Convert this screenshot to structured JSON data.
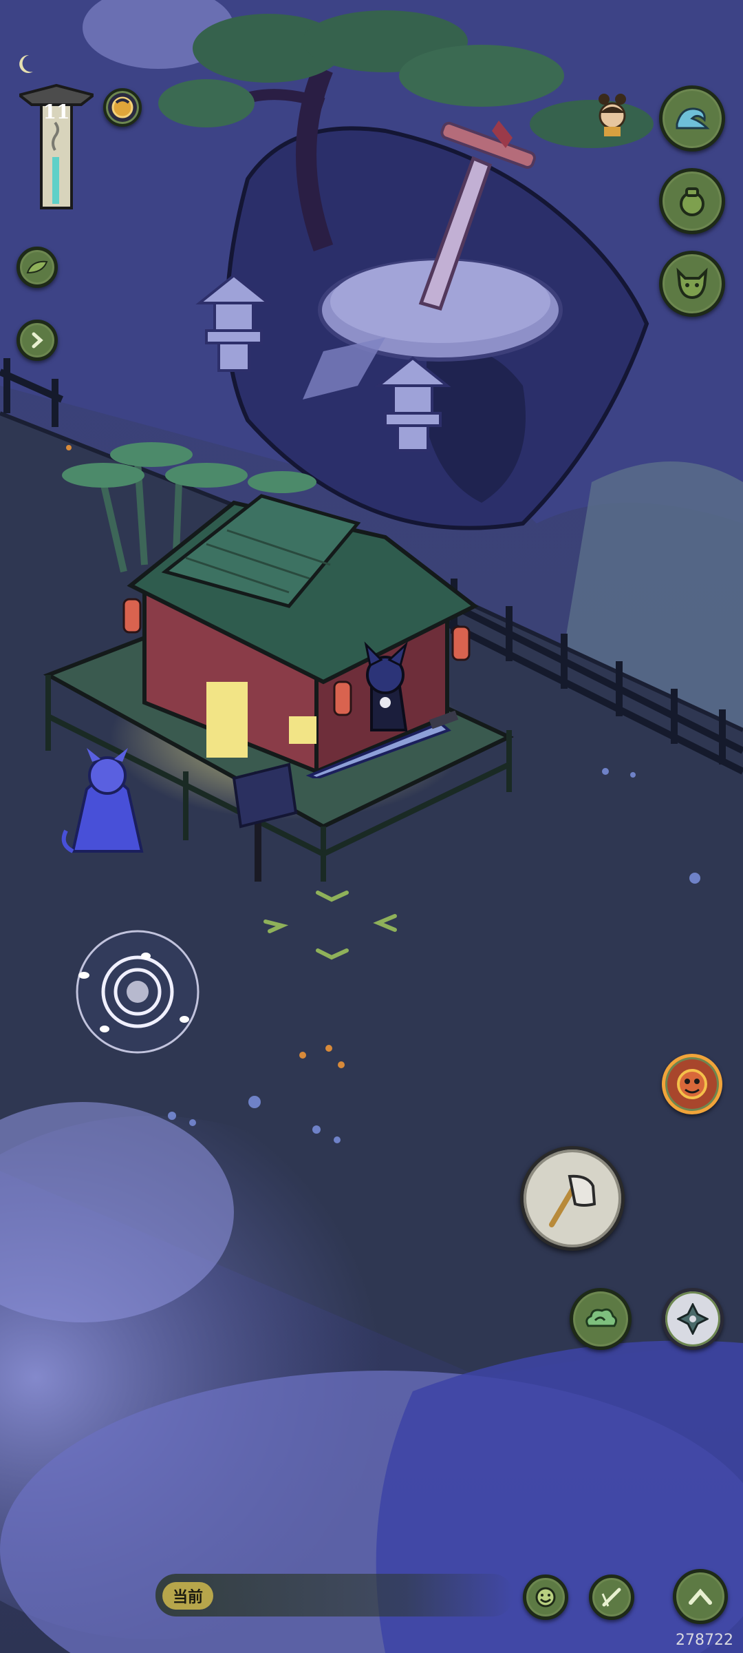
{
  "hud": {
    "level": "11",
    "chat_channel_tag": "当前",
    "watermark": "278722"
  },
  "icons": {
    "moon": "crescent-moon-icon",
    "time_orb": "sun-moon-orb-icon",
    "leaf": "leaf-icon",
    "expand": "chevron-right-icon",
    "portrait": "character-portrait-icon",
    "wave": "wave-skill-icon",
    "gourd": "gourd-bag-icon",
    "demon": "demon-mask-icon",
    "lion": "lion-dance-icon",
    "axe": "axe-action-icon",
    "cloud": "cloud-skill-icon",
    "shuriken": "shuriken-skill-icon",
    "emoji": "emoji-icon",
    "brush": "brush-note-icon",
    "up": "chevron-up-icon"
  },
  "colors": {
    "sky": "#2b2f5c",
    "ground": "#2f3752",
    "button_green": "#5d7a44",
    "accent_gold": "#e0a53a"
  }
}
